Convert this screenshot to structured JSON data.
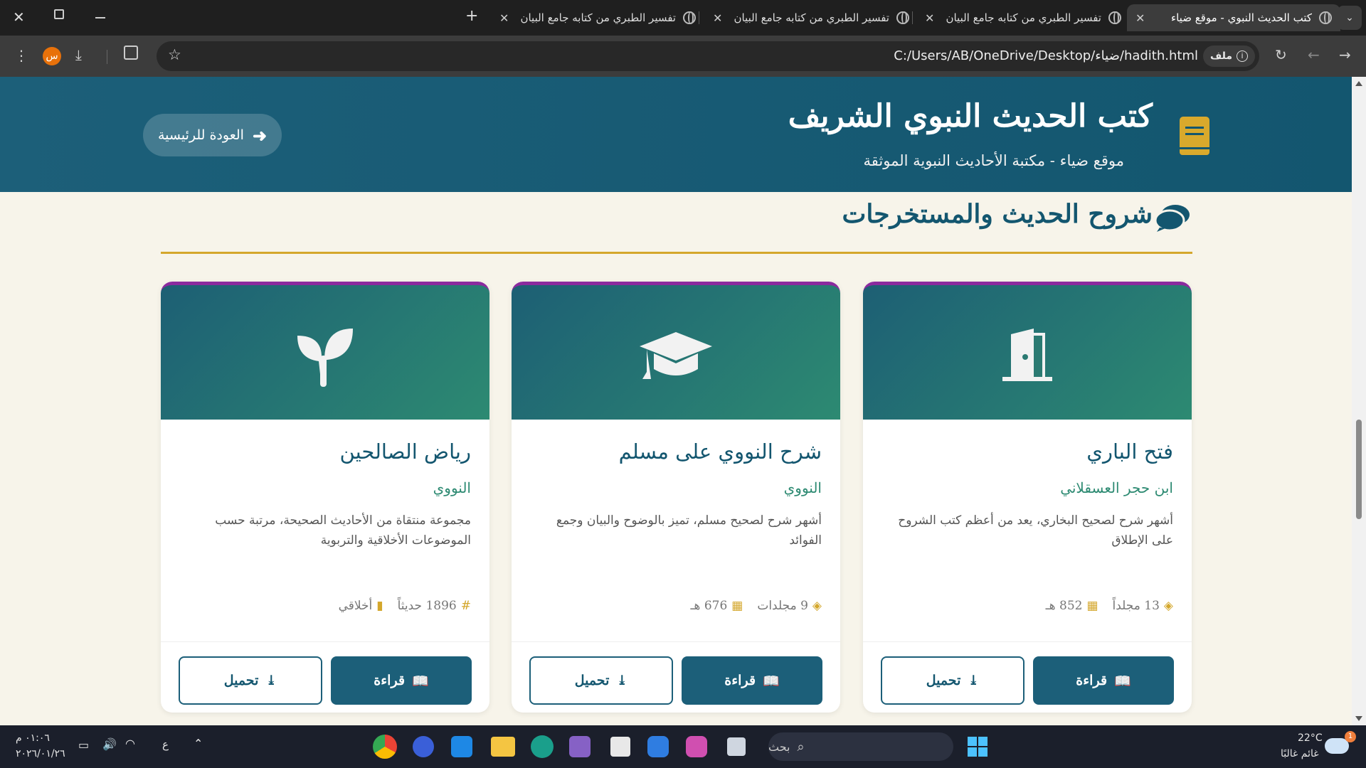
{
  "browser": {
    "tabs": [
      {
        "title": "كتب الحديث النبوي - موقع ضياء",
        "active": true
      },
      {
        "title": "تفسير الطبري من كتابه جامع البيان",
        "active": false
      },
      {
        "title": "تفسير الطبري من كتابه جامع البيان",
        "active": false
      },
      {
        "title": "تفسير الطبري من كتابه جامع البيان",
        "active": false
      }
    ],
    "new_tab": "+",
    "address": {
      "scheme_label": "ملف",
      "url": "C:/Users/AB/OneDrive/Desktop/ضياء/hadith.html"
    },
    "profile_initial": "س"
  },
  "header": {
    "title": "كتب الحديث النبوي الشريف",
    "subtitle": "موقع ضياء - مكتبة الأحاديث النبوية الموثقة",
    "back_label": "العودة للرئيسية"
  },
  "section": {
    "title": "شروح الحديث والمستخرجات"
  },
  "cards": [
    {
      "name": "فتح الباري",
      "author": "ابن حجر العسقلاني",
      "description": "أشهر شرح لصحيح البخاري، يعد من أعظم كتب الشروح على الإطلاق",
      "meta1": "13 مجلداً",
      "meta2": "852 هـ",
      "icon": "door-open-icon"
    },
    {
      "name": "شرح النووي على مسلم",
      "author": "النووي",
      "description": "أشهر شرح لصحيح مسلم، تميز بالوضوح والبيان وجمع الفوائد",
      "meta1": "9 مجلدات",
      "meta2": "676 هـ",
      "icon": "graduation-cap-icon"
    },
    {
      "name": "رياض الصالحين",
      "author": "النووي",
      "description": "مجموعة منتقاة من الأحاديث الصحيحة، مرتبة حسب الموضوعات الأخلاقية والتربوية",
      "meta1": "1896 حديثاً",
      "meta2": "أخلاقي",
      "icon": "seedling-icon"
    }
  ],
  "buttons": {
    "read": "قراءة",
    "download": "تحميل"
  },
  "taskbar": {
    "search_placeholder": "بحث",
    "weather_temp": "22°C",
    "weather_desc": "غائم غالبًا",
    "time": "٠١:٠٦ م",
    "date": "٢٠٢٦/٠١/٢٦",
    "lang": "ع",
    "notification_count": "1"
  },
  "colors": {
    "primary": "#1c5f79",
    "accent": "#d4a72c",
    "card_gradient_end": "#2d8a72",
    "card_border": "#8b2a9e",
    "page_bg": "#f7f4ea"
  }
}
